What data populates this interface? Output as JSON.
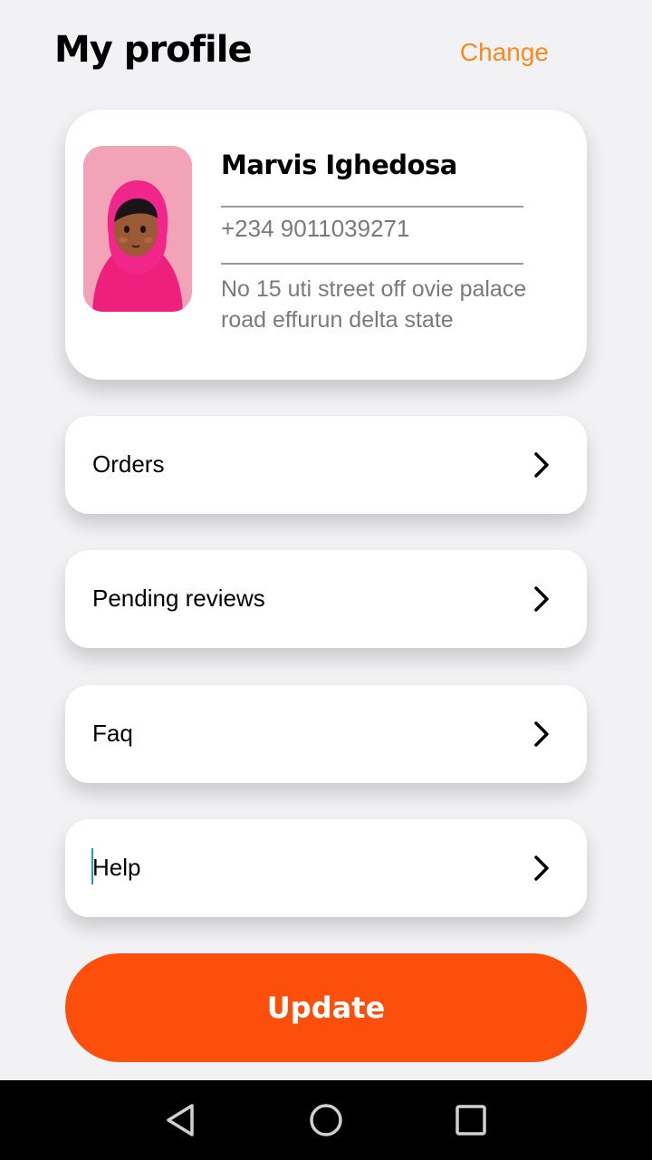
{
  "header": {
    "title": "My profile",
    "change_label": "Change"
  },
  "profile": {
    "name": "Marvis Ighedosa",
    "phone": "+234 9011039271",
    "address": "No 15 uti street off ovie palace road effurun delta state"
  },
  "menu": [
    {
      "label": "Orders",
      "icon": "chevron-right-icon"
    },
    {
      "label": "Pending reviews",
      "icon": "chevron-right-icon"
    },
    {
      "label": "Faq",
      "icon": "chevron-right-icon"
    },
    {
      "label": "Help",
      "icon": "chevron-right-icon"
    }
  ],
  "update_button": {
    "label": "Update"
  },
  "nav": {
    "icons": [
      "back-triangle-icon",
      "home-circle-icon",
      "recents-square-icon"
    ]
  },
  "colors": {
    "accent": "#fd4f0c",
    "link": "#fa8a1a",
    "background": "#f2f2f4",
    "avatar_bg": "#f3a3b8"
  }
}
